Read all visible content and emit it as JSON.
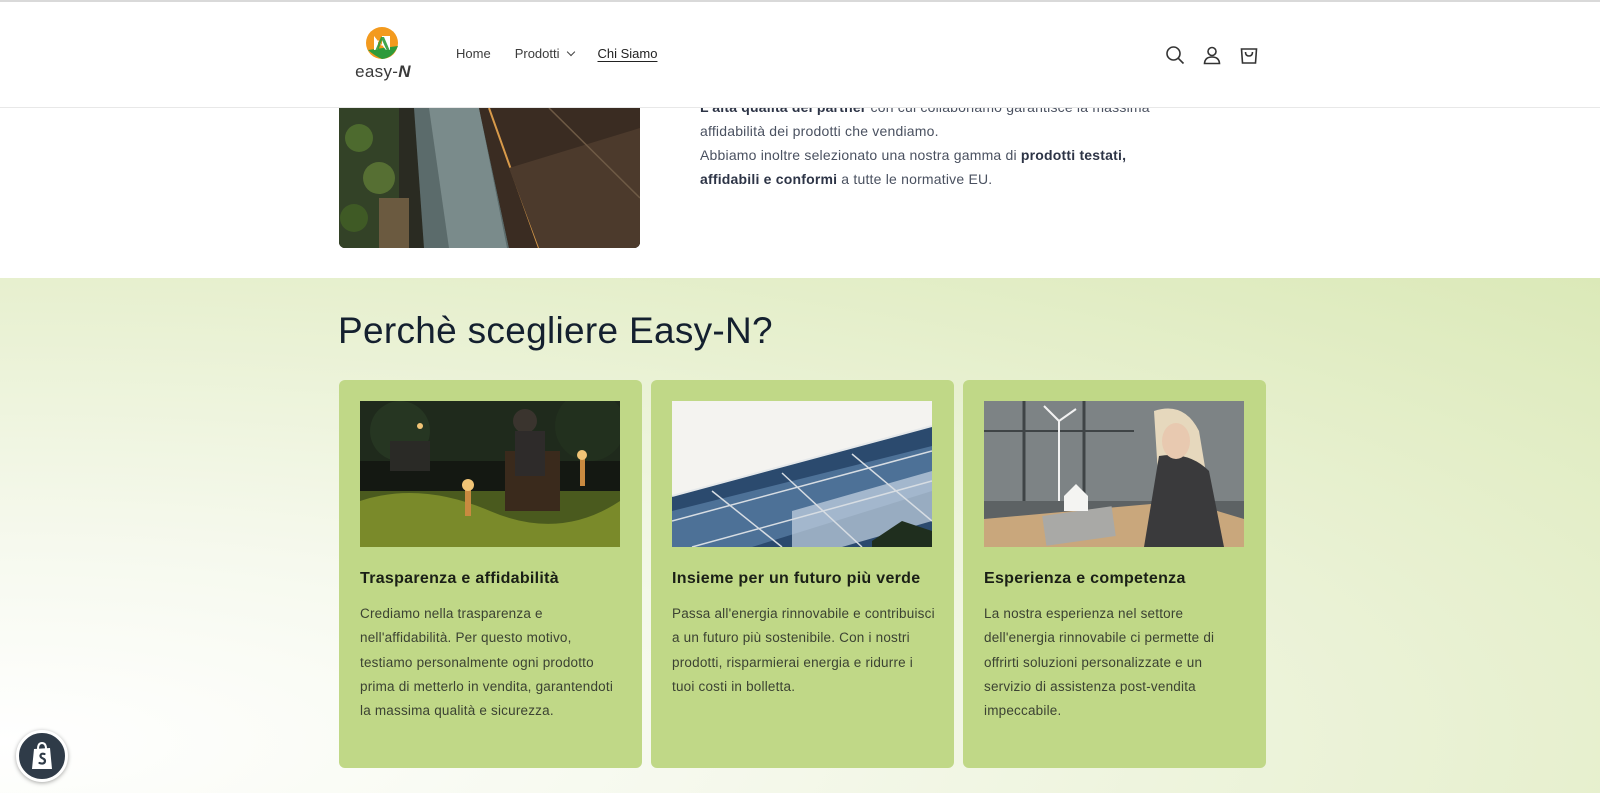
{
  "header": {
    "logo_text_main": "easy-",
    "logo_text_letter": "N",
    "nav": [
      {
        "label": "Home"
      },
      {
        "label": "Prodotti"
      },
      {
        "label": "Chi Siamo"
      }
    ],
    "icons": [
      "search-icon",
      "account-icon",
      "cart-icon"
    ]
  },
  "intro": {
    "line1_bold": "L'alta qualità dei partner",
    "line1_rest": " con cui collaboriamo garantisce la massima",
    "line2": "affidabilità dei prodotti che vendiamo.",
    "line3_pre": "Abbiamo inoltre selezionato una nostra gamma di ",
    "line3_bold": "prodotti testati,",
    "line4_bold": "affidabili e conformi",
    "line4_rest": " a tutte le normative EU."
  },
  "why": {
    "title": "Perchè scegliere Easy-N?",
    "cards": [
      {
        "title": "Trasparenza e affidabilità",
        "text": "Crediamo nella trasparenza e nell'affidabilità. Per questo motivo, testiamo personalmente ogni prodotto prima di metterlo in vendita, garantendoti la massima qualità e sicurezza."
      },
      {
        "title": "Insieme per un futuro più verde",
        "text": "Passa all'energia rinnovabile e contribuisci a un futuro più sostenibile. Con i nostri prodotti, risparmierai energia e ridurre i tuoi costi in bolletta."
      },
      {
        "title": "Esperienza e competenza",
        "text": "La nostra esperienza nel settore dell'energia rinnovabile ci permette di offrirti soluzioni personalizzate e un servizio di assistenza post-vendita impeccabile."
      }
    ]
  },
  "colors": {
    "card_bg": "#c0d887",
    "heading": "#14202f",
    "logo_orange": "#f39a1e",
    "logo_green": "#2e9a3a"
  }
}
